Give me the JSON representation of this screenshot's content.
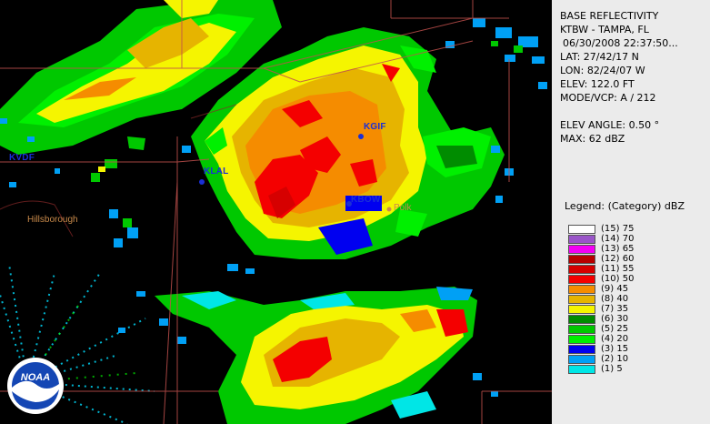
{
  "product": {
    "title": "BASE REFLECTIVITY",
    "station": "KTBW - TAMPA, FL",
    "datetime": "06/30/2008 22:37:50...",
    "lat": "LAT: 27/42/17 N",
    "lon": "LON: 82/24/07 W",
    "elev": "ELEV: 122.0 FT",
    "mode": "MODE/VCP: A / 212",
    "elev_angle": "ELEV ANGLE: 0.50 °",
    "max": "MAX: 62 dBZ"
  },
  "legend": {
    "title": "Legend: (Category) dBZ",
    "items": [
      {
        "label": "(15) 75",
        "color": "#ffffff"
      },
      {
        "label": "(14) 70",
        "color": "#9a55c9"
      },
      {
        "label": "(13) 65",
        "color": "#f300f3"
      },
      {
        "label": "(12) 60",
        "color": "#b80000"
      },
      {
        "label": "(11) 55",
        "color": "#d60000"
      },
      {
        "label": "(10) 50",
        "color": "#f40000"
      },
      {
        "label": "(9) 45",
        "color": "#f58c00"
      },
      {
        "label": "(8) 40",
        "color": "#e6b400"
      },
      {
        "label": "(7) 35",
        "color": "#f5f500"
      },
      {
        "label": "(6) 30",
        "color": "#008c00"
      },
      {
        "label": "(5) 25",
        "color": "#00c800"
      },
      {
        "label": "(4) 20",
        "color": "#00f000"
      },
      {
        "label": "(3) 15",
        "color": "#0000f0"
      },
      {
        "label": "(2) 10",
        "color": "#00a0f5"
      },
      {
        "label": "(1) 5",
        "color": "#00e6e6"
      }
    ]
  },
  "sites": [
    "KVDF",
    "KLAL",
    "KGIF",
    "KBOW"
  ],
  "counties": [
    "Hillsborough",
    "Polk"
  ],
  "logo": "NOAA"
}
